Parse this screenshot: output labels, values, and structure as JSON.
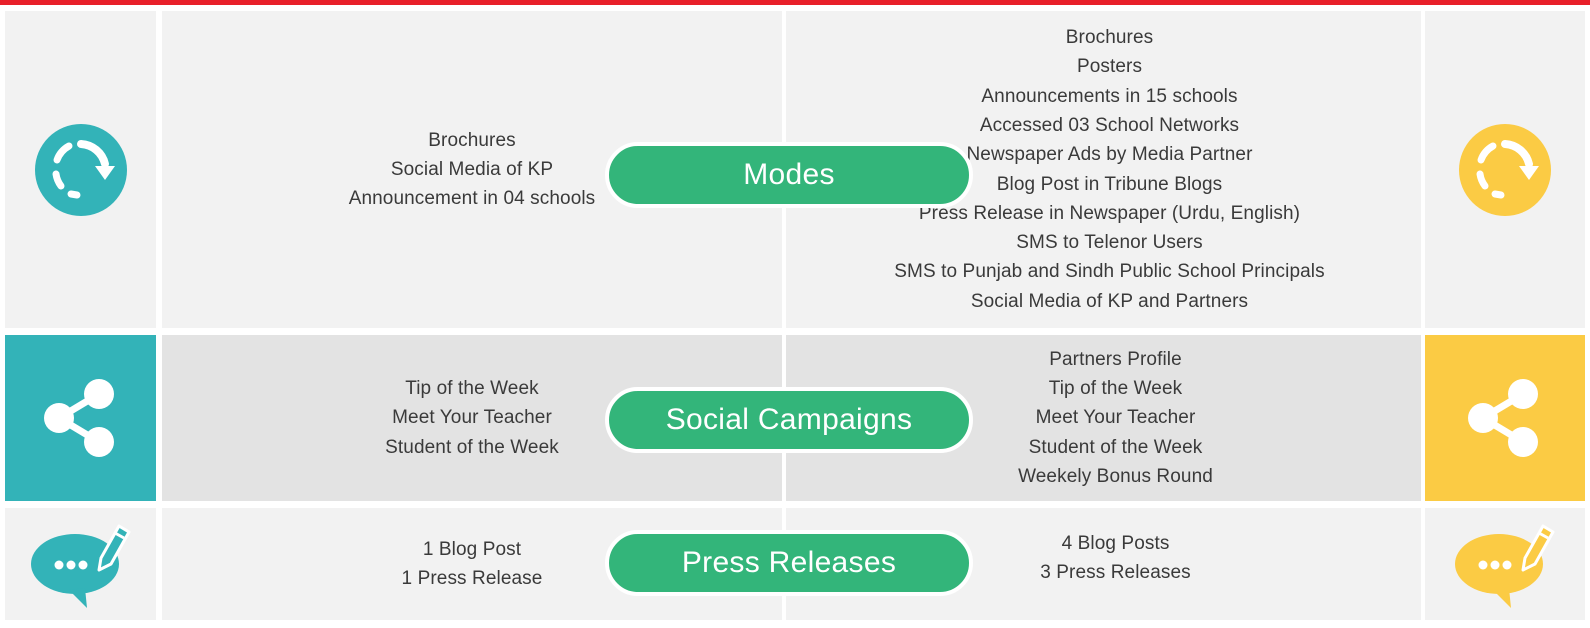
{
  "colors": {
    "accent_red": "#e8202a",
    "teal": "#33b3b8",
    "yellow": "#fbcb44",
    "green": "#33b57a",
    "row_light": "#f2f2f2",
    "row_mid": "#e3e3e3"
  },
  "rows": [
    {
      "label": "Modes",
      "icon": "refresh-cycle-icon",
      "left_items": [
        "Brochures",
        "Social Media of KP",
        "Announcement in 04 schools"
      ],
      "right_items": [
        "Brochures",
        "Posters",
        "Announcements in 15 schools",
        "Accessed 03 School Networks",
        "Newspaper Ads by Media Partner",
        "Blog Post in Tribune Blogs",
        "Press Release in Newspaper (Urdu, English)",
        "SMS to Telenor Users",
        "SMS to Punjab and Sindh Public School Principals",
        "Social Media of KP and Partners"
      ]
    },
    {
      "label": "Social Campaigns",
      "icon": "share-icon",
      "left_items": [
        "Tip of the Week",
        "Meet Your Teacher",
        "Student of the Week"
      ],
      "right_items": [
        "Partners Profile",
        "Tip of the Week",
        "Meet Your Teacher",
        "Student of the Week",
        "Weekely Bonus Round"
      ]
    },
    {
      "label": "Press Releases",
      "icon": "chat-bubble-pen-icon",
      "left_items": [
        "1 Blog Post",
        "1 Press Release"
      ],
      "right_items": [
        "4 Blog Posts",
        "3 Press Releases"
      ]
    }
  ]
}
